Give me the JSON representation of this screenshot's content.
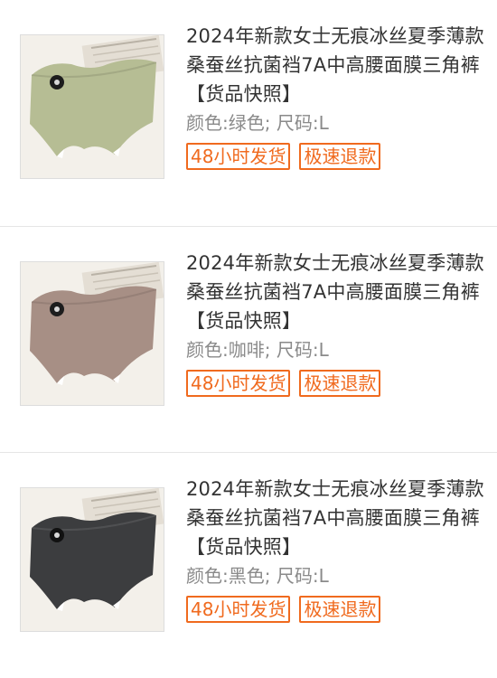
{
  "colors": {
    "accent": "#f06a1e",
    "title_text": "#333333",
    "spec_text": "#8a8a8a",
    "divider": "#e6e6e6"
  },
  "items": [
    {
      "image_icon": "product-photo-underwear-green",
      "garment_color": "#b6bd94",
      "title": "2024年新款女士无痕冰丝夏季薄款桑蚕丝抗菌裆7A中高腰面膜三角裤 【货品快照】",
      "spec": "颜色:绿色;  尺码:L",
      "tags": [
        "48小时发货",
        "极速退款"
      ]
    },
    {
      "image_icon": "product-photo-underwear-coffee",
      "garment_color": "#a78f85",
      "title": "2024年新款女士无痕冰丝夏季薄款桑蚕丝抗菌裆7A中高腰面膜三角裤 【货品快照】",
      "spec": "颜色:咖啡;  尺码:L",
      "tags": [
        "48小时发货",
        "极速退款"
      ]
    },
    {
      "image_icon": "product-photo-underwear-black",
      "garment_color": "#3c3d3f",
      "title": "2024年新款女士无痕冰丝夏季薄款桑蚕丝抗菌裆7A中高腰面膜三角裤 【货品快照】",
      "spec": "颜色:黑色;  尺码:L",
      "tags": [
        "48小时发货",
        "极速退款"
      ]
    }
  ]
}
